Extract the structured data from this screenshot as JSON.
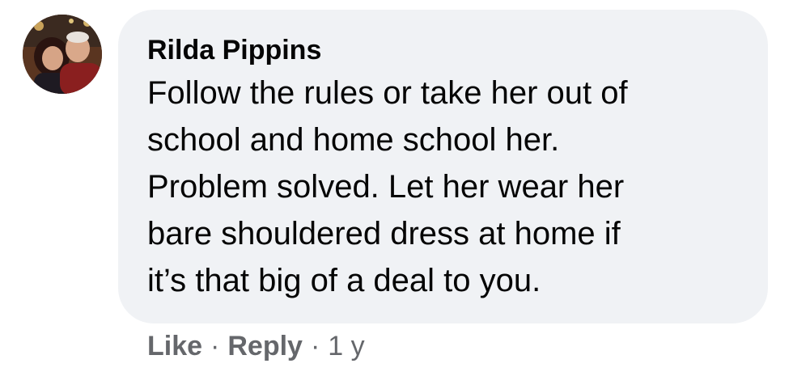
{
  "comment": {
    "author": "Rilda Pippins",
    "lines": [
      "Follow the rules or take her out of",
      "school and home school her.",
      "Problem solved. Let her wear her",
      "bare shouldered dress at home if",
      "it’s that big of a deal to you."
    ],
    "avatar": "profile-photo"
  },
  "actions": {
    "like_label": "Like",
    "separator": "·",
    "reply_label": "Reply",
    "timestamp": "1 y"
  },
  "colors": {
    "bubble_bg": "#f0f2f5",
    "text": "#050505",
    "meta": "#65676b"
  }
}
